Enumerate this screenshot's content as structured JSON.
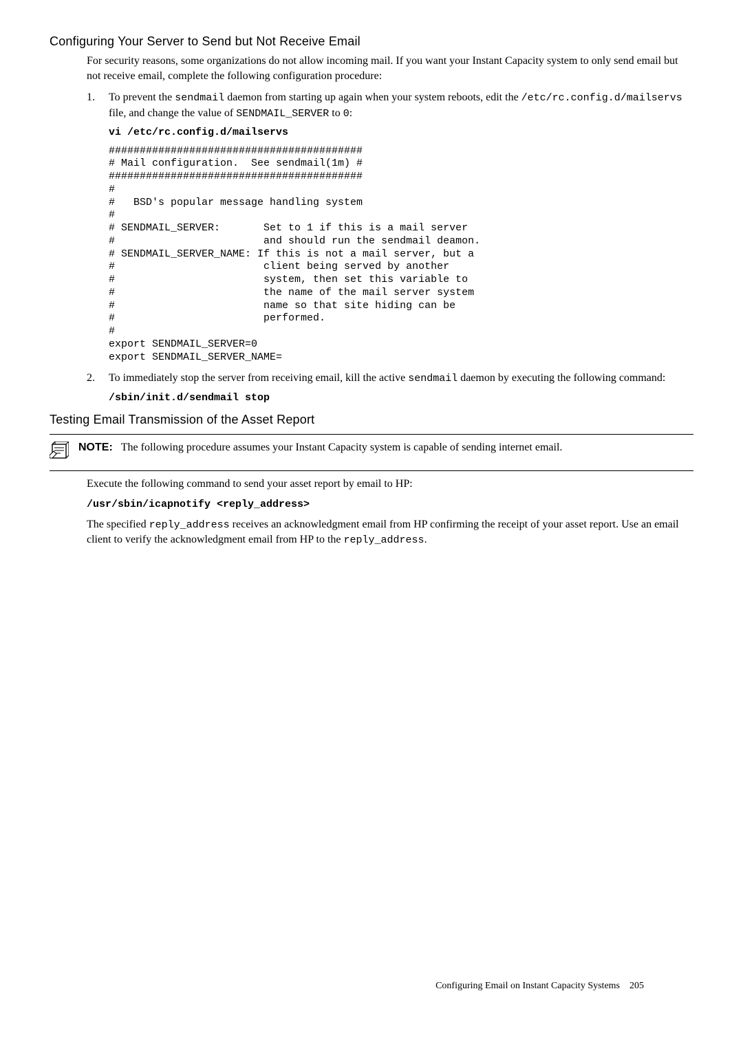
{
  "section1": {
    "heading": "Configuring Your Server to Send but Not Receive Email",
    "intro": "For security reasons, some organizations do not allow incoming mail. If you want your Instant Capacity system to only send email but not receive email, complete the following configuration procedure:",
    "step1_text_a": "To prevent the ",
    "step1_code_a": "sendmail",
    "step1_text_b": " daemon from starting up again when your system reboots, edit the ",
    "step1_code_b": "/etc/rc.config.d/mailservs",
    "step1_text_c": " file, and change the value of ",
    "step1_code_c": "SENDMAIL_SERVER",
    "step1_text_d": " to ",
    "step1_code_d": "0",
    "step1_text_e": ":",
    "step1_cmd": "vi /etc/rc.config.d/mailservs",
    "config_block": "#########################################\n# Mail configuration.  See sendmail(1m) #\n#########################################\n#\n#   BSD's popular message handling system\n#\n# SENDMAIL_SERVER:       Set to 1 if this is a mail server\n#                        and should run the sendmail deamon.\n# SENDMAIL_SERVER_NAME: If this is not a mail server, but a\n#                        client being served by another\n#                        system, then set this variable to\n#                        the name of the mail server system\n#                        name so that site hiding can be\n#                        performed.\n#\nexport SENDMAIL_SERVER=0\nexport SENDMAIL_SERVER_NAME=",
    "step2_text_a": "To immediately stop the server from receiving email, kill the active ",
    "step2_code_a": "sendmail",
    "step2_text_b": " daemon by executing the following command:",
    "step2_cmd": "/sbin/init.d/sendmail stop"
  },
  "section2": {
    "heading": "Testing Email Transmission of the Asset Report",
    "note_label": "NOTE:",
    "note_text": "The following procedure assumes your Instant Capacity system is capable of sending internet email.",
    "para1": "Execute the following command to send your asset report by email to HP:",
    "cmd": "/usr/sbin/icapnotify <reply_address>",
    "para2_a": "The specified ",
    "para2_code_a": "reply_address",
    "para2_b": " receives an acknowledgment email from HP confirming the receipt of your asset report. Use an email client to verify the acknowledgment email from HP to the ",
    "para2_code_b": "reply_address",
    "para2_c": "."
  },
  "footer": {
    "title": "Configuring Email on Instant Capacity Systems",
    "page": "205"
  }
}
